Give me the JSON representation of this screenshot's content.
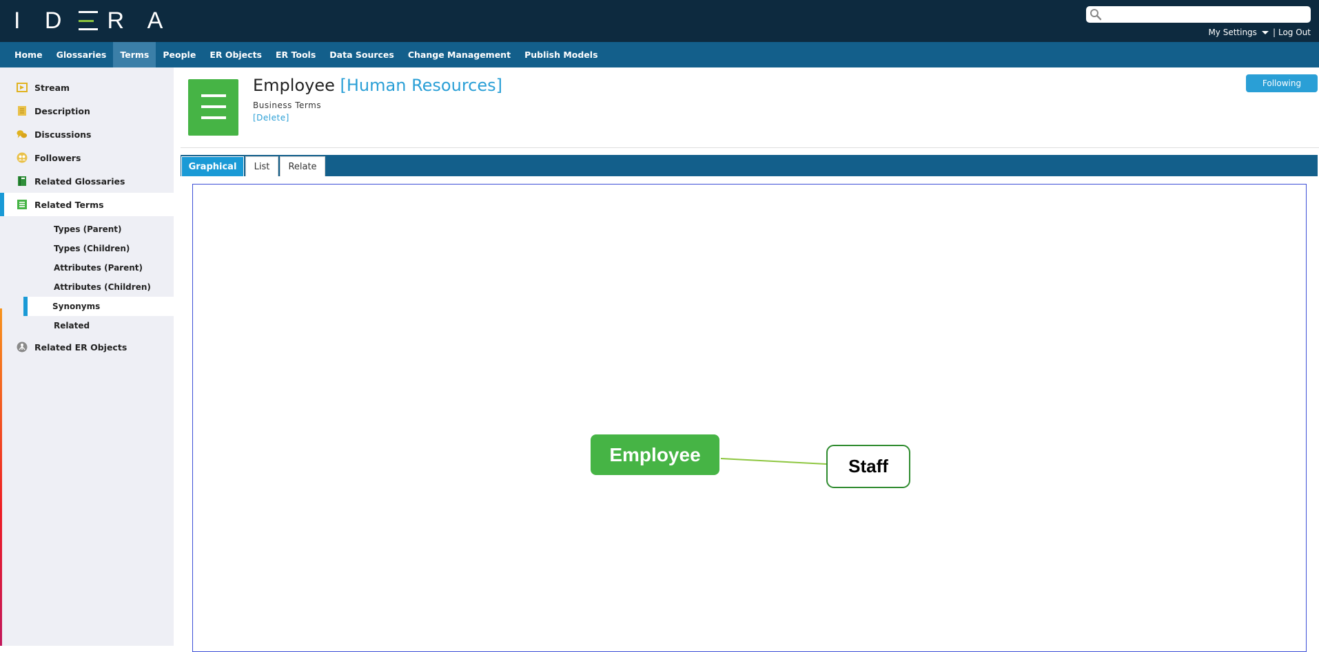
{
  "brand": {
    "logo_text": "IDERA"
  },
  "search": {
    "placeholder": ""
  },
  "user_menu": {
    "settings": "My Settings",
    "separator": "|",
    "logout": "Log Out"
  },
  "nav": {
    "items": [
      {
        "label": "Home"
      },
      {
        "label": "Glossaries"
      },
      {
        "label": "Terms",
        "active": true
      },
      {
        "label": "People"
      },
      {
        "label": "ER Objects"
      },
      {
        "label": "ER Tools"
      },
      {
        "label": "Data Sources"
      },
      {
        "label": "Change Management"
      },
      {
        "label": "Publish Models"
      }
    ]
  },
  "sidebar": {
    "items": [
      {
        "label": "Stream",
        "icon": "stream-icon"
      },
      {
        "label": "Description",
        "icon": "description-icon"
      },
      {
        "label": "Discussions",
        "icon": "discussions-icon"
      },
      {
        "label": "Followers",
        "icon": "followers-icon"
      },
      {
        "label": "Related Glossaries",
        "icon": "glossary-book-icon"
      },
      {
        "label": "Related Terms",
        "icon": "term-list-icon",
        "active": true
      },
      {
        "label": "Related ER Objects",
        "icon": "er-object-icon"
      }
    ],
    "sub_items": [
      {
        "label": "Types (Parent)"
      },
      {
        "label": "Types (Children)"
      },
      {
        "label": "Attributes (Parent)"
      },
      {
        "label": "Attributes (Children)"
      },
      {
        "label": "Synonyms",
        "active": true
      },
      {
        "label": "Related"
      }
    ]
  },
  "term": {
    "name": "Employee",
    "glossary": "[Human Resources]",
    "type": "Business Terms",
    "delete_label": "[Delete]",
    "follow_label": "Following"
  },
  "tabs": [
    {
      "label": "Graphical",
      "active": true
    },
    {
      "label": "List"
    },
    {
      "label": "Relate"
    }
  ],
  "diagram": {
    "nodes": [
      {
        "label": "Employee",
        "role": "current-term"
      },
      {
        "label": "Staff",
        "role": "synonym"
      }
    ],
    "colors": {
      "primary_node": "#46b445",
      "related_border": "#2e8b2e",
      "edge": "#8dc63f"
    }
  },
  "colors": {
    "topbar": "#0d2a3f",
    "nav": "#135f8b",
    "accent": "#2a9fd6",
    "brand_green": "#46b445"
  }
}
